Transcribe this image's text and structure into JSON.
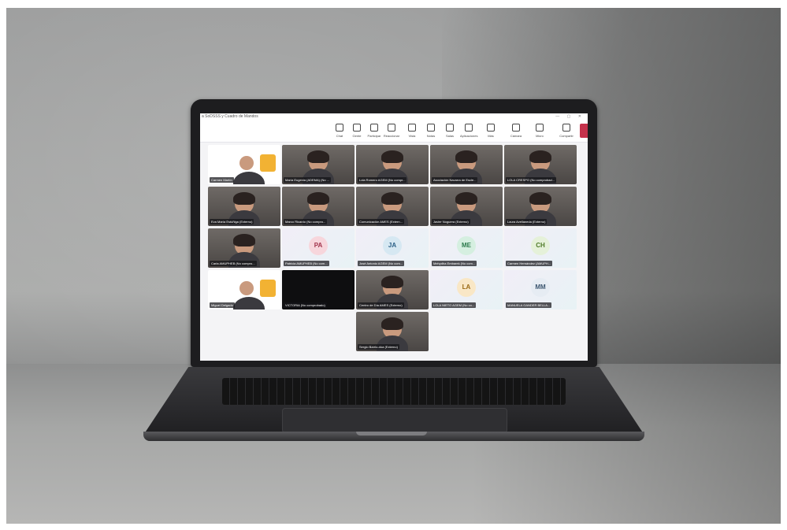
{
  "window": {
    "title": "a SoDSSS y Cuadro de Mandos"
  },
  "toolbar": [
    {
      "label": "Chat",
      "icon": "chat-icon"
    },
    {
      "label": "Gente",
      "icon": "people-icon"
    },
    {
      "label": "Participar",
      "icon": "hand-icon"
    },
    {
      "label": "Reaccionar",
      "icon": "emoji-icon"
    },
    {
      "label": "Vista",
      "icon": "view-icon"
    },
    {
      "label": "Notas",
      "icon": "notes-icon"
    },
    {
      "label": "Salas",
      "icon": "rooms-icon"
    },
    {
      "label": "Aplicaciones",
      "icon": "apps-icon"
    },
    {
      "label": "Más",
      "icon": "more-icon"
    },
    {
      "label": "Cámara",
      "icon": "camera-icon"
    },
    {
      "label": "Micro",
      "icon": "mic-icon"
    },
    {
      "label": "Compartir",
      "icon": "share-icon"
    }
  ],
  "participants": [
    {
      "name": "Carmen Martín",
      "type": "poster"
    },
    {
      "name": "María Eugenia (ADEMA) (No ...",
      "type": "video"
    },
    {
      "name": "Lola Romero AGEM (No compr...",
      "type": "video"
    },
    {
      "name": "Asociación Navarra de Escle...",
      "type": "video"
    },
    {
      "name": "LOLA CRESPO (No comprobad...",
      "type": "video"
    },
    {
      "name": "Eva María Estúñiga (Externo)",
      "type": "video"
    },
    {
      "name": "Marco Ricardo (No compro...",
      "type": "video"
    },
    {
      "name": "Comunicación AMES (Extern...",
      "type": "video"
    },
    {
      "name": "Javier Noguera (Externo)",
      "type": "video"
    },
    {
      "name": "Laura Avellaneda (Externo)",
      "type": "video"
    },
    {
      "name": "Carla AMUPHEB (No compro...",
      "type": "video"
    },
    {
      "name": "Patricia AMUPHEB (No com...",
      "type": "avatar",
      "initials": "PA",
      "color": "#f7d6dc",
      "text": "#a1334b"
    },
    {
      "name": "José Antonio AGEM (No com...",
      "type": "avatar",
      "initials": "JA",
      "color": "#d6e8f2",
      "text": "#2a5f86"
    },
    {
      "name": "Mehydha Embarek (No com...",
      "type": "avatar",
      "initials": "ME",
      "color": "#d5efe0",
      "text": "#2b7a4b"
    },
    {
      "name": "Carmen Hernández (AMUPH...",
      "type": "avatar",
      "initials": "CH",
      "color": "#e5f1d9",
      "text": "#4d7a26"
    },
    {
      "name": "Miguel Delgado",
      "type": "poster"
    },
    {
      "name": "VICTORIA (No comprobado)",
      "type": "black"
    },
    {
      "name": "Centro de Día AMES (Externo)",
      "type": "video"
    },
    {
      "name": "LOLA NIETO AGEM (No co...",
      "type": "avatar",
      "initials": "LA",
      "color": "#f9e7c6",
      "text": "#9a6a14"
    },
    {
      "name": "MANUELA GANDER BELLA...",
      "type": "avatar",
      "initials": "MM",
      "color": "#e6ecf3",
      "text": "#3c5670"
    },
    {
      "name": "Sergio Barrio-dúa (Externo)",
      "type": "video"
    }
  ]
}
